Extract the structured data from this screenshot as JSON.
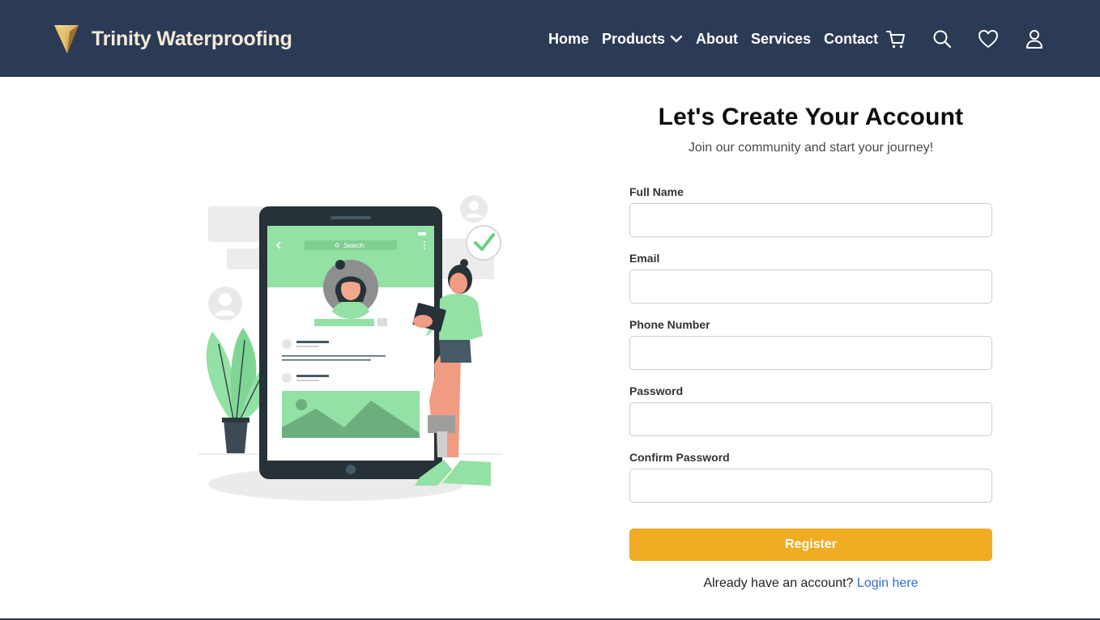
{
  "header": {
    "brand_name": "Trinity Waterproofing",
    "nav": [
      {
        "label": "Home"
      },
      {
        "label": "Products"
      },
      {
        "label": "About"
      },
      {
        "label": "Services"
      },
      {
        "label": "Contact"
      }
    ],
    "icons": [
      "cart-icon",
      "search-icon",
      "heart-icon",
      "user-icon"
    ]
  },
  "form": {
    "title": "Let's Create Your Account",
    "subtitle": "Join our community and start your journey!",
    "fields": [
      {
        "label": "Full Name",
        "value": "",
        "placeholder": ""
      },
      {
        "label": "Email",
        "value": "",
        "placeholder": ""
      },
      {
        "label": "Phone Number",
        "value": "",
        "placeholder": ""
      },
      {
        "label": "Password",
        "value": "",
        "placeholder": ""
      },
      {
        "label": "Confirm Password",
        "value": "",
        "placeholder": ""
      }
    ],
    "register_label": "Register",
    "login_prompt": "Already have an account?",
    "login_link": "Login here"
  },
  "illustration": {
    "search_label": "Search"
  },
  "colors": {
    "header_bg": "#2b3a55",
    "brand_text": "#f5ead9",
    "accent": "#f0ac22",
    "link": "#2f6bd6",
    "illustration_green": "#93e1a4"
  }
}
